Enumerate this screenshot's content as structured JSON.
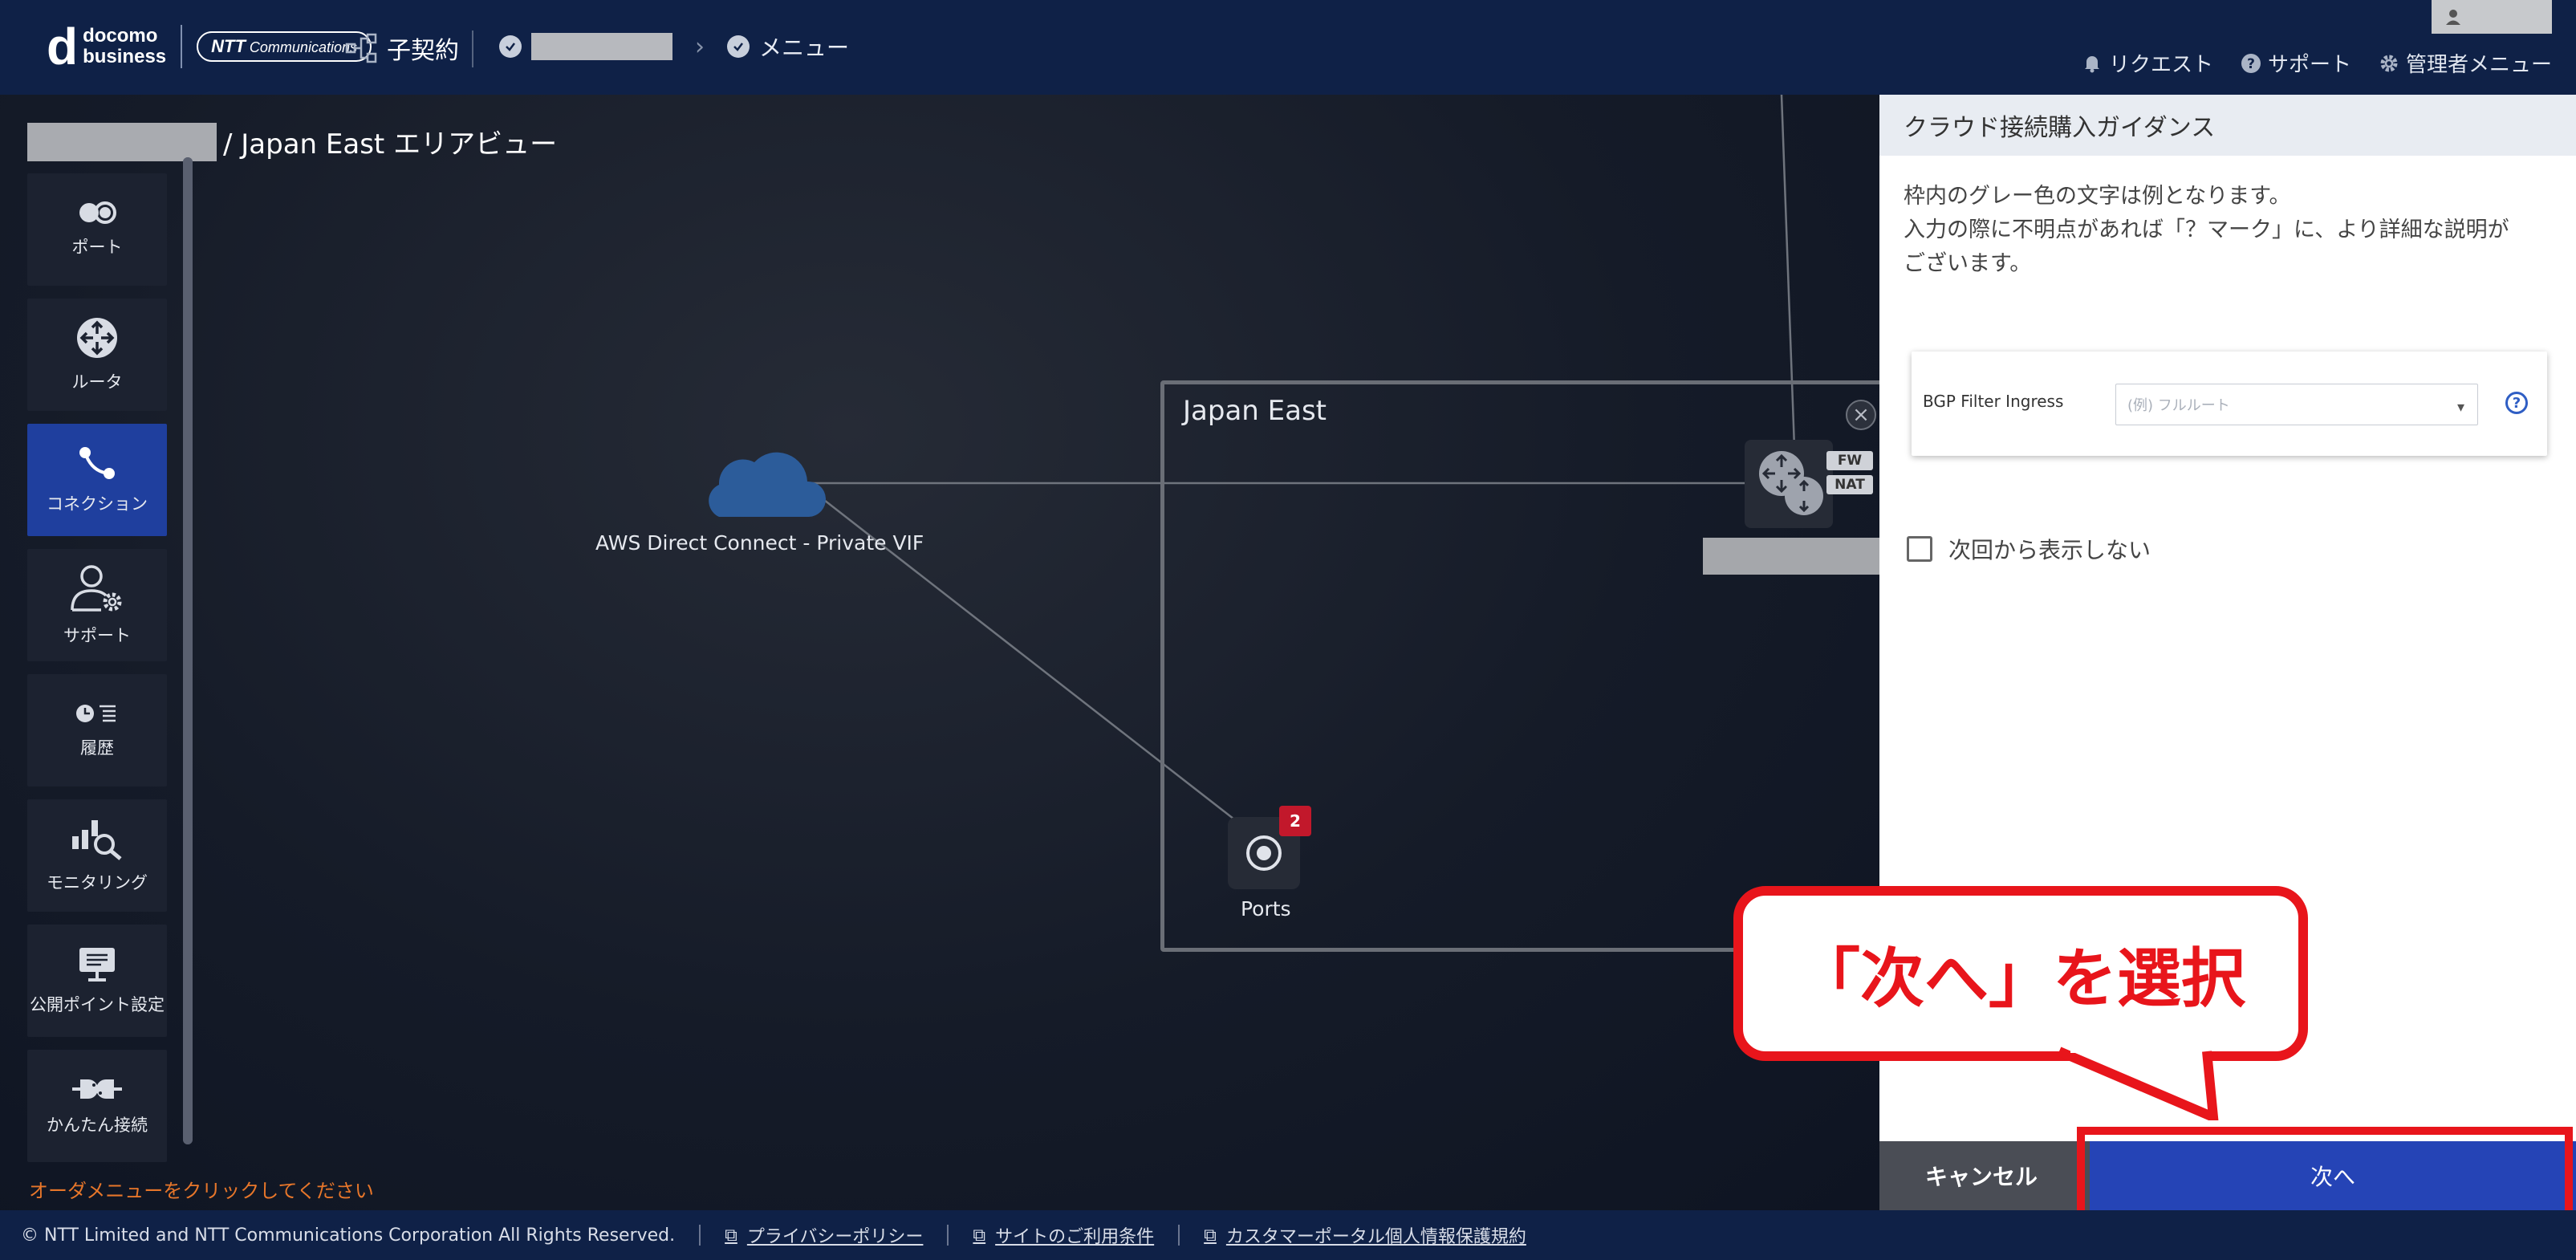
{
  "header": {
    "logo_d": "d",
    "logo_line1": "docomo",
    "logo_line2": "business",
    "ntt_logo_prefix": "NTT",
    "ntt_logo_suffix": "Communications",
    "contract_label": "子契約",
    "crumb_menu": "メニュー",
    "nav": {
      "request": "リクエスト",
      "support": "サポート",
      "admin_menu": "管理者メニュー"
    }
  },
  "main": {
    "title": "/ Japan East エリアビュー",
    "sidebar": [
      {
        "label": "ポート",
        "icon": "port-icon",
        "active": false
      },
      {
        "label": "ルータ",
        "icon": "router-icon",
        "active": false
      },
      {
        "label": "コネクション",
        "icon": "connection-icon",
        "active": true
      },
      {
        "label": "サポート",
        "icon": "support-user-icon",
        "active": false
      },
      {
        "label": "履歴",
        "icon": "history-icon",
        "active": false
      },
      {
        "label": "モニタリング",
        "icon": "monitoring-icon",
        "active": false
      },
      {
        "label": "公開ポイント設定",
        "icon": "public-point-icon",
        "active": false
      },
      {
        "label": "かんたん接続",
        "icon": "easy-connect-icon",
        "active": false
      }
    ],
    "order_message": "オーダメニューをクリックしてください",
    "region_title": "Japan East",
    "cloud_label": "AWS Direct Connect - Private VIF",
    "ports_label": "Ports",
    "ports_badge": "2",
    "router_tags": [
      "FW",
      "NAT"
    ]
  },
  "panel": {
    "title": "クラウド接続購入ガイダンス",
    "desc_line1": "枠内のグレー色の文字は例となります。",
    "desc_line2": "入力の際に不明点があれば「？マーク」に、より詳細な説明が",
    "desc_line3": "ございます。",
    "bgp_label": "BGP Filter Ingress",
    "bgp_placeholder": "(例) フルルート",
    "checkbox_label": "次回から表示しない",
    "cancel_label": "キャンセル",
    "next_label": "次へ"
  },
  "annotation": {
    "callout_text": "「次へ」を選択"
  },
  "footer": {
    "copyright": "© NTT Limited and NTT Communications Corporation All Rights Reserved.",
    "privacy": "プライバシーポリシー",
    "terms": "サイトのご利用条件",
    "customer_privacy": "カスタマーポータル個人情報保護規約"
  },
  "colors": {
    "header_bg": "#0f2147",
    "accent_blue": "#2544b6",
    "annotation_red": "#e8151b",
    "warning_orange": "#e7762a",
    "badge_red": "#c2182b"
  }
}
